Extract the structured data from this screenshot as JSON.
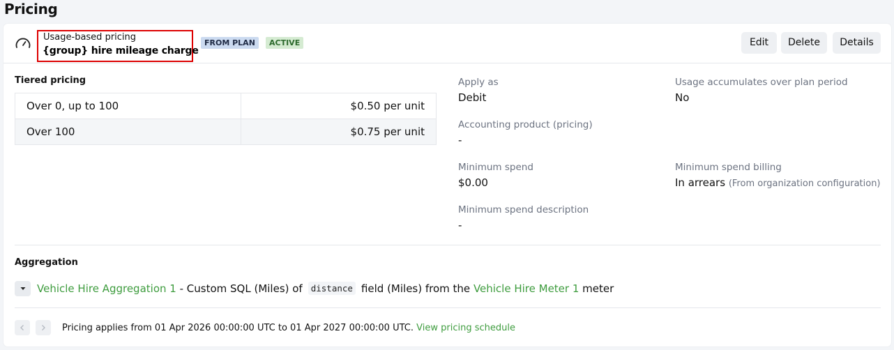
{
  "page": {
    "title": "Pricing"
  },
  "charge": {
    "subtitle": "Usage-based pricing",
    "name": "{group} hire mileage charge",
    "badges": {
      "plan": "FROM PLAN",
      "status": "ACTIVE"
    },
    "actions": {
      "edit": "Edit",
      "delete": "Delete",
      "details": "Details"
    },
    "icon": "gauge-icon"
  },
  "tiered_pricing": {
    "label": "Tiered pricing",
    "tiers": [
      {
        "range": "Over 0, up to 100",
        "price": "$0.50 per unit"
      },
      {
        "range": "Over 100",
        "price": "$0.75 per unit"
      }
    ]
  },
  "fields": {
    "apply_as": {
      "label": "Apply as",
      "value": "Debit"
    },
    "usage_accumulates": {
      "label": "Usage accumulates over plan period",
      "value": "No"
    },
    "accounting_product": {
      "label": "Accounting product (pricing)",
      "value": "-"
    },
    "minimum_spend": {
      "label": "Minimum spend",
      "value": "$0.00"
    },
    "minimum_spend_billing": {
      "label": "Minimum spend billing",
      "value": "In arrears",
      "note": "(From organization configuration)"
    },
    "minimum_spend_description": {
      "label": "Minimum spend description",
      "value": "-"
    }
  },
  "aggregation": {
    "label": "Aggregation",
    "aggregation_link": "Vehicle Hire Aggregation 1",
    "text_1": " - Custom SQL (Miles) of",
    "field_code": "distance",
    "text_2": "field (Miles) from the ",
    "meter_link": "Vehicle Hire Meter 1",
    "text_3": " meter"
  },
  "footer": {
    "text": "Pricing applies from 01 Apr 2026 00:00:00 UTC to 01 Apr 2027 00:00:00 UTC. ",
    "link": "View pricing schedule"
  },
  "colors": {
    "accent_link": "#3e9c3e",
    "highlight_box": "#dd0000"
  }
}
